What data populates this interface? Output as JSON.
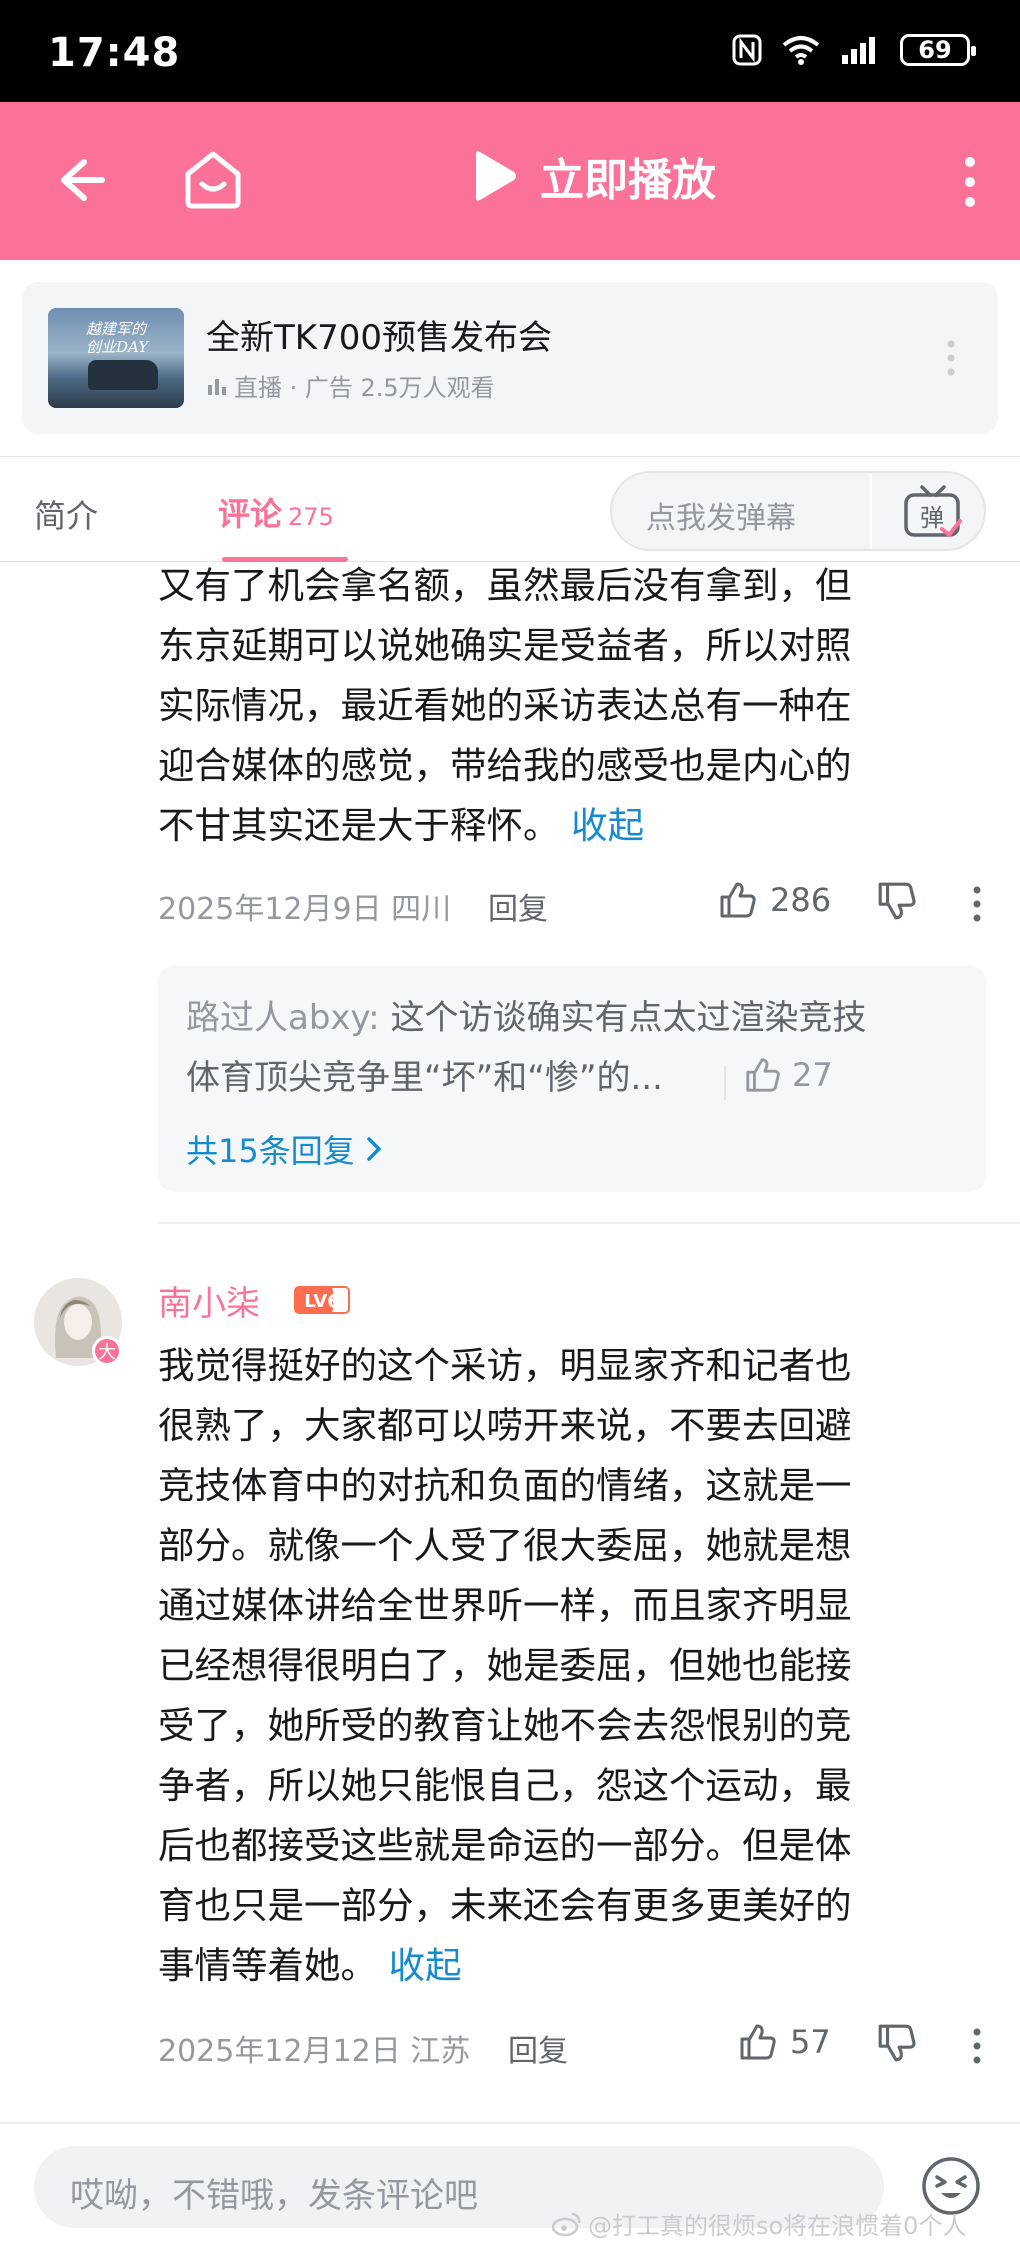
{
  "status_bar": {
    "time": "17:48",
    "battery": "69"
  },
  "top_bar": {
    "play_label": "立即播放"
  },
  "ad": {
    "thumb_text": "越建军的\n创业DAY",
    "title": "全新TK700预售发布会",
    "meta": "直播 · 广告  2.5万人观看"
  },
  "tabs": {
    "intro": "简介",
    "comments": "评论",
    "comments_count": "275",
    "danmaku_placeholder": "点我发弹幕",
    "danmaku_button": "弹"
  },
  "comments": [
    {
      "text_lines": [
        "又有了机会拿名额，虽然最后没有拿到，但",
        "东京延期可以说她确实是受益者，所以对照",
        "实际情况，最近看她的采访表达总有一种在",
        "迎合媒体的感觉，带给我的感受也是内心的",
        "不甘其实还是大于释怀。"
      ],
      "collapse": "收起",
      "date": "2025年12月9日 四川",
      "reply": "回复",
      "likes": "286",
      "sub_reply": {
        "user": "路过人abxy:",
        "text_line1": " 这个访谈确实有点太过渲染竞技",
        "text_line2": "体育顶尖竞争里“坏”和“惨”的...",
        "likes": "27",
        "all_replies": "共15条回复"
      }
    },
    {
      "username": "南小柒",
      "level": "LV6",
      "avatar_badge": "大",
      "text_lines": [
        "我觉得挺好的这个采访，明显家齐和记者也",
        "很熟了，大家都可以唠开来说，不要去回避",
        "竞技体育中的对抗和负面的情绪，这就是一",
        "部分。就像一个人受了很大委屈，她就是想",
        "通过媒体讲给全世界听一样，而且家齐明显",
        "已经想得很明白了，她是委屈，但她也能接",
        "受了，她所受的教育让她不会去怨恨别的竞",
        "争者，所以她只能恨自己，怨这个运动，最",
        "后也都接受这些就是命运的一部分。但是体",
        "育也只是一部分，未来还会有更多更美好的",
        "事情等着她。"
      ],
      "collapse": "收起",
      "date": "2025年12月12日 江苏",
      "reply": "回复",
      "likes": "57"
    }
  ],
  "bottom": {
    "input_placeholder": "哎呦，不错哦，发条评论吧",
    "watermark": "@打工真的很烦so将在浪惯着0个人"
  },
  "colors": {
    "accent": "#fb7299",
    "link": "#178bcf"
  }
}
